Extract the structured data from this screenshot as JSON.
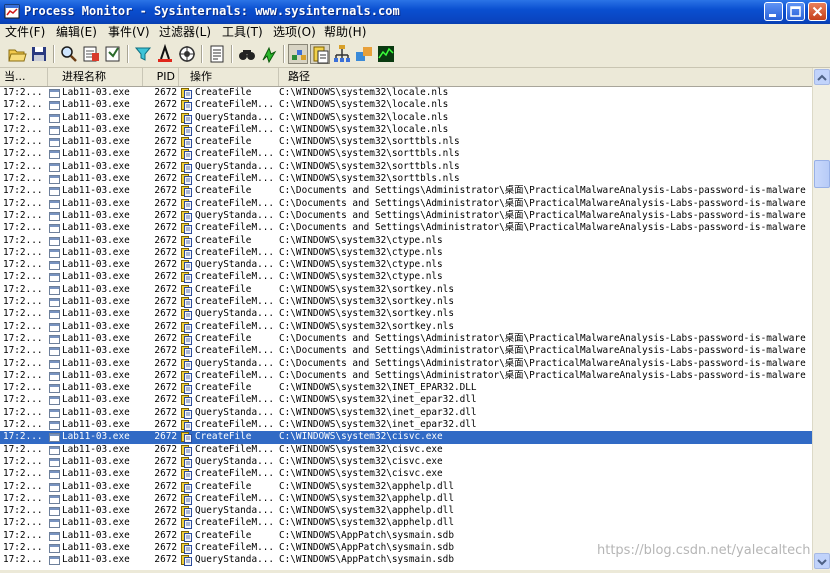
{
  "window": {
    "title": "Process Monitor - Sysinternals: www.sysinternals.com"
  },
  "menu": [
    "文件(F)",
    "编辑(E)",
    "事件(V)",
    "过滤器(L)",
    "工具(T)",
    "选项(O)",
    "帮助(H)"
  ],
  "toolbar": [
    "open-icon",
    "save-icon",
    "magnify-icon",
    "capture-icon",
    "autoscroll-icon",
    "clear-icon",
    "filter-icon",
    "highlight-icon",
    "network-target-icon",
    "properties-icon",
    "find-icon",
    "jump-icon",
    "registry-icon",
    "filesystem-icon",
    "network-icon",
    "process-icon",
    "profiling-icon"
  ],
  "columns": [
    "当...",
    "进程名称",
    "PID",
    "操作",
    "路径"
  ],
  "rows": [
    {
      "time": "17:2...",
      "process": "Lab11-03.exe",
      "pid": "2672",
      "op": "CreateFile",
      "path": "C:\\WINDOWS\\system32\\locale.nls"
    },
    {
      "time": "17:2...",
      "process": "Lab11-03.exe",
      "pid": "2672",
      "op": "CreateFileM...",
      "path": "C:\\WINDOWS\\system32\\locale.nls"
    },
    {
      "time": "17:2...",
      "process": "Lab11-03.exe",
      "pid": "2672",
      "op": "QueryStanda...",
      "path": "C:\\WINDOWS\\system32\\locale.nls"
    },
    {
      "time": "17:2...",
      "process": "Lab11-03.exe",
      "pid": "2672",
      "op": "CreateFileM...",
      "path": "C:\\WINDOWS\\system32\\locale.nls"
    },
    {
      "time": "17:2...",
      "process": "Lab11-03.exe",
      "pid": "2672",
      "op": "CreateFile",
      "path": "C:\\WINDOWS\\system32\\sorttbls.nls"
    },
    {
      "time": "17:2...",
      "process": "Lab11-03.exe",
      "pid": "2672",
      "op": "CreateFileM...",
      "path": "C:\\WINDOWS\\system32\\sorttbls.nls"
    },
    {
      "time": "17:2...",
      "process": "Lab11-03.exe",
      "pid": "2672",
      "op": "QueryStanda...",
      "path": "C:\\WINDOWS\\system32\\sorttbls.nls"
    },
    {
      "time": "17:2...",
      "process": "Lab11-03.exe",
      "pid": "2672",
      "op": "CreateFileM...",
      "path": "C:\\WINDOWS\\system32\\sorttbls.nls"
    },
    {
      "time": "17:2...",
      "process": "Lab11-03.exe",
      "pid": "2672",
      "op": "CreateFile",
      "path": "C:\\Documents and Settings\\Administrator\\桌面\\PracticalMalwareAnalysis-Labs-password-is-malware"
    },
    {
      "time": "17:2...",
      "process": "Lab11-03.exe",
      "pid": "2672",
      "op": "CreateFileM...",
      "path": "C:\\Documents and Settings\\Administrator\\桌面\\PracticalMalwareAnalysis-Labs-password-is-malware"
    },
    {
      "time": "17:2...",
      "process": "Lab11-03.exe",
      "pid": "2672",
      "op": "QueryStanda...",
      "path": "C:\\Documents and Settings\\Administrator\\桌面\\PracticalMalwareAnalysis-Labs-password-is-malware"
    },
    {
      "time": "17:2...",
      "process": "Lab11-03.exe",
      "pid": "2672",
      "op": "CreateFileM...",
      "path": "C:\\Documents and Settings\\Administrator\\桌面\\PracticalMalwareAnalysis-Labs-password-is-malware"
    },
    {
      "time": "17:2...",
      "process": "Lab11-03.exe",
      "pid": "2672",
      "op": "CreateFile",
      "path": "C:\\WINDOWS\\system32\\ctype.nls"
    },
    {
      "time": "17:2...",
      "process": "Lab11-03.exe",
      "pid": "2672",
      "op": "CreateFileM...",
      "path": "C:\\WINDOWS\\system32\\ctype.nls"
    },
    {
      "time": "17:2...",
      "process": "Lab11-03.exe",
      "pid": "2672",
      "op": "QueryStanda...",
      "path": "C:\\WINDOWS\\system32\\ctype.nls"
    },
    {
      "time": "17:2...",
      "process": "Lab11-03.exe",
      "pid": "2672",
      "op": "CreateFileM...",
      "path": "C:\\WINDOWS\\system32\\ctype.nls"
    },
    {
      "time": "17:2...",
      "process": "Lab11-03.exe",
      "pid": "2672",
      "op": "CreateFile",
      "path": "C:\\WINDOWS\\system32\\sortkey.nls"
    },
    {
      "time": "17:2...",
      "process": "Lab11-03.exe",
      "pid": "2672",
      "op": "CreateFileM...",
      "path": "C:\\WINDOWS\\system32\\sortkey.nls"
    },
    {
      "time": "17:2...",
      "process": "Lab11-03.exe",
      "pid": "2672",
      "op": "QueryStanda...",
      "path": "C:\\WINDOWS\\system32\\sortkey.nls"
    },
    {
      "time": "17:2...",
      "process": "Lab11-03.exe",
      "pid": "2672",
      "op": "CreateFileM...",
      "path": "C:\\WINDOWS\\system32\\sortkey.nls"
    },
    {
      "time": "17:2...",
      "process": "Lab11-03.exe",
      "pid": "2672",
      "op": "CreateFile",
      "path": "C:\\Documents and Settings\\Administrator\\桌面\\PracticalMalwareAnalysis-Labs-password-is-malware"
    },
    {
      "time": "17:2...",
      "process": "Lab11-03.exe",
      "pid": "2672",
      "op": "CreateFileM...",
      "path": "C:\\Documents and Settings\\Administrator\\桌面\\PracticalMalwareAnalysis-Labs-password-is-malware"
    },
    {
      "time": "17:2...",
      "process": "Lab11-03.exe",
      "pid": "2672",
      "op": "QueryStanda...",
      "path": "C:\\Documents and Settings\\Administrator\\桌面\\PracticalMalwareAnalysis-Labs-password-is-malware"
    },
    {
      "time": "17:2...",
      "process": "Lab11-03.exe",
      "pid": "2672",
      "op": "CreateFileM...",
      "path": "C:\\Documents and Settings\\Administrator\\桌面\\PracticalMalwareAnalysis-Labs-password-is-malware"
    },
    {
      "time": "17:2...",
      "process": "Lab11-03.exe",
      "pid": "2672",
      "op": "CreateFile",
      "path": "C:\\WINDOWS\\system32\\INET_EPAR32.DLL"
    },
    {
      "time": "17:2...",
      "process": "Lab11-03.exe",
      "pid": "2672",
      "op": "CreateFileM...",
      "path": "C:\\WINDOWS\\system32\\inet_epar32.dll"
    },
    {
      "time": "17:2...",
      "process": "Lab11-03.exe",
      "pid": "2672",
      "op": "QueryStanda...",
      "path": "C:\\WINDOWS\\system32\\inet_epar32.dll"
    },
    {
      "time": "17:2...",
      "process": "Lab11-03.exe",
      "pid": "2672",
      "op": "CreateFileM...",
      "path": "C:\\WINDOWS\\system32\\inet_epar32.dll"
    },
    {
      "time": "17:2...",
      "process": "Lab11-03.exe",
      "pid": "2672",
      "op": "CreateFile",
      "path": "C:\\WINDOWS\\system32\\cisvc.exe",
      "selected": true
    },
    {
      "time": "17:2...",
      "process": "Lab11-03.exe",
      "pid": "2672",
      "op": "CreateFileM...",
      "path": "C:\\WINDOWS\\system32\\cisvc.exe"
    },
    {
      "time": "17:2...",
      "process": "Lab11-03.exe",
      "pid": "2672",
      "op": "QueryStanda...",
      "path": "C:\\WINDOWS\\system32\\cisvc.exe"
    },
    {
      "time": "17:2...",
      "process": "Lab11-03.exe",
      "pid": "2672",
      "op": "CreateFileM...",
      "path": "C:\\WINDOWS\\system32\\cisvc.exe"
    },
    {
      "time": "17:2...",
      "process": "Lab11-03.exe",
      "pid": "2672",
      "op": "CreateFile",
      "path": "C:\\WINDOWS\\system32\\apphelp.dll"
    },
    {
      "time": "17:2...",
      "process": "Lab11-03.exe",
      "pid": "2672",
      "op": "CreateFileM...",
      "path": "C:\\WINDOWS\\system32\\apphelp.dll"
    },
    {
      "time": "17:2...",
      "process": "Lab11-03.exe",
      "pid": "2672",
      "op": "QueryStanda...",
      "path": "C:\\WINDOWS\\system32\\apphelp.dll"
    },
    {
      "time": "17:2...",
      "process": "Lab11-03.exe",
      "pid": "2672",
      "op": "CreateFileM...",
      "path": "C:\\WINDOWS\\system32\\apphelp.dll"
    },
    {
      "time": "17:2...",
      "process": "Lab11-03.exe",
      "pid": "2672",
      "op": "CreateFile",
      "path": "C:\\WINDOWS\\AppPatch\\sysmain.sdb"
    },
    {
      "time": "17:2...",
      "process": "Lab11-03.exe",
      "pid": "2672",
      "op": "CreateFileM...",
      "path": "C:\\WINDOWS\\AppPatch\\sysmain.sdb"
    },
    {
      "time": "17:2...",
      "process": "Lab11-03.exe",
      "pid": "2672",
      "op": "QueryStanda...",
      "path": "C:\\WINDOWS\\AppPatch\\sysmain.sdb"
    }
  ],
  "watermark": "https://blog.csdn.net/yalecaltech",
  "colors": {
    "selection": "#316ac5",
    "titlebar": "#0a4fd0"
  }
}
